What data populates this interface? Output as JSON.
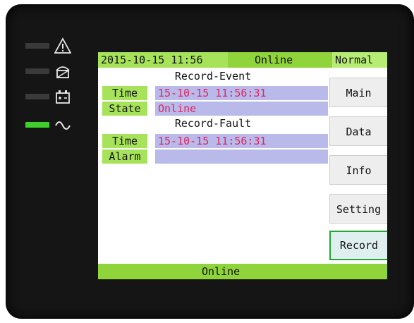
{
  "header": {
    "datetime": "2015-10-15 11:56",
    "status": "Online",
    "mode": "Normal"
  },
  "record_event": {
    "title": "Record-Event",
    "time_label": "Time",
    "time_value": "15-10-15 11:56:31",
    "state_label": "State",
    "state_value": "Online"
  },
  "record_fault": {
    "title": "Record-Fault",
    "time_label": "Time",
    "time_value": "15-10-15 11:56:31",
    "alarm_label": "Alarm",
    "alarm_value": ""
  },
  "menu": {
    "main": "Main",
    "data": "Data",
    "info": "Info",
    "setting": "Setting",
    "record": "Record"
  },
  "footer": {
    "status": "Online"
  },
  "indicators": [
    {
      "icon": "warning-triangle-icon",
      "on": false
    },
    {
      "icon": "bypass-icon",
      "on": false
    },
    {
      "icon": "battery-icon",
      "on": false
    },
    {
      "icon": "ac-wave-icon",
      "on": true
    }
  ],
  "colors": {
    "bar_green": "#8fd43a",
    "label_green": "#a6e35a",
    "value_bg": "#b9b9ea",
    "value_text": "#e0245e",
    "led_on": "#3fcf2a"
  }
}
